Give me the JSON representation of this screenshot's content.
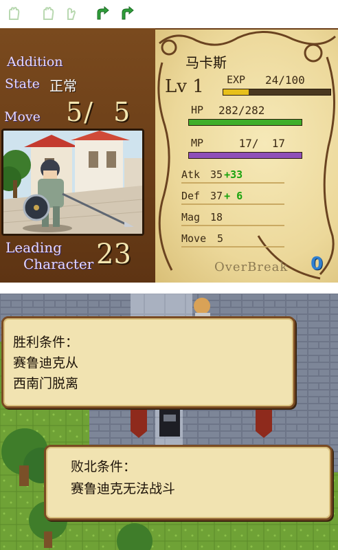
{
  "toolbar": {
    "icons": [
      "hand-icon",
      "hand-icon",
      "hand-icon",
      "undo-arrow-icon",
      "redo-arrow-icon"
    ],
    "colors": {
      "inactive": "#b8d8b0",
      "active": "#2f9e3a"
    }
  },
  "status": {
    "addition_label": "Addition",
    "state_label": "State",
    "state_value": "正常",
    "move_label": "Move",
    "move_value": "5/  5",
    "leading_label": "Leading",
    "character_label": "Character",
    "leading_value": "23",
    "character_name": "马卡斯",
    "level_label": "Lv 1",
    "exp_label": "EXP",
    "exp_value": "24/100",
    "exp_fraction": 0.24,
    "hp_label": "HP",
    "hp_value": "282/282",
    "hp_fraction": 1.0,
    "mp_label": "MP",
    "mp_value": " 17/  17",
    "mp_fraction": 1.0,
    "stats": [
      {
        "label": "Atk",
        "value": "35",
        "bonus": "+33"
      },
      {
        "label": "Def",
        "value": "37",
        "bonus": "+ 6"
      },
      {
        "label": "Mag",
        "value": "18",
        "bonus": ""
      },
      {
        "label": "Move",
        "value": "5",
        "bonus": ""
      }
    ],
    "overbreak_label": "OverBreak",
    "overbreak_value": "0",
    "colors": {
      "exp": "#e7c01a",
      "hp": "#3fae2a",
      "mp": "#8f4fb8",
      "bonus": "#1aa30e"
    }
  },
  "map": {
    "victory_title": "胜利条件：",
    "victory_line1": "赛鲁迪克从",
    "victory_line2": "西南门脱离",
    "defeat_title": "败北条件：",
    "defeat_line1": "赛鲁迪克无法战斗"
  }
}
